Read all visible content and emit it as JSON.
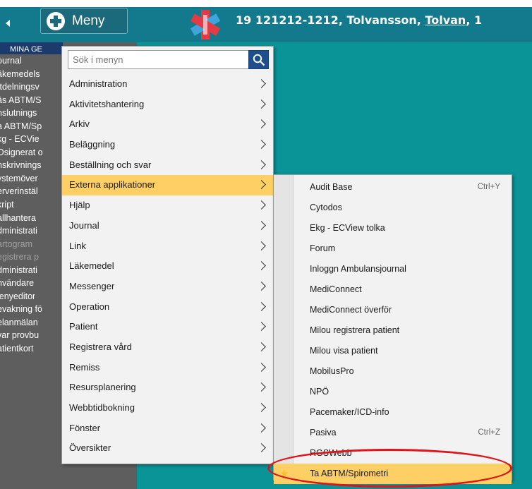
{
  "topbar": {
    "menu_label": "Meny",
    "patient_id": "19 121212-1212",
    "patient_surname": "Tolvansson",
    "patient_given": "Tolvan",
    "patient_trailing": "1"
  },
  "left_panel": {
    "header": "MINA GE",
    "items": [
      "ournal",
      "äkemedels",
      "Itdelningsv",
      "äs ABTM/S",
      "nslutnings",
      "a ABTM/Sp",
      "kg - ECVie",
      "Osignerat o",
      "nskrivnings",
      "ystemöver",
      "erverinstäl",
      "kript",
      "allhantera",
      "dministrati",
      "artogram",
      "egistrera p",
      "dministrati",
      "nvändare",
      "lenyeditor",
      "evakning fö",
      "elanmälan",
      "var provbu",
      "atientkort"
    ]
  },
  "menu": {
    "search_placeholder": "Sök i menyn",
    "items": [
      "Administration",
      "Aktivitetshantering",
      "Arkiv",
      "Beläggning",
      "Beställning och svar",
      "Externa applikationer",
      "Hjälp",
      "Journal",
      "Link",
      "Läkemedel",
      "Messenger",
      "Operation",
      "Patient",
      "Registrera vård",
      "Remiss",
      "Resursplanering",
      "Webbtidbokning",
      "Fönster",
      "Översikter"
    ],
    "active_index": 5
  },
  "submenu": {
    "items": [
      {
        "label": "Audit Base",
        "shortcut": "Ctrl+Y"
      },
      {
        "label": "Cytodos",
        "shortcut": ""
      },
      {
        "label": "Ekg - ECView tolka",
        "shortcut": ""
      },
      {
        "label": "Forum",
        "shortcut": ""
      },
      {
        "label": "Inloggn Ambulansjournal",
        "shortcut": ""
      },
      {
        "label": "MediConnect",
        "shortcut": ""
      },
      {
        "label": "MediConnect överför",
        "shortcut": ""
      },
      {
        "label": "Milou registrera patient",
        "shortcut": ""
      },
      {
        "label": "Milou visa patient",
        "shortcut": ""
      },
      {
        "label": "MobilusPro",
        "shortcut": ""
      },
      {
        "label": "NPÖ",
        "shortcut": ""
      },
      {
        "label": "Pacemaker/ICD-info",
        "shortcut": ""
      },
      {
        "label": "Pasiva",
        "shortcut": "Ctrl+Z"
      },
      {
        "label": "RGSWebb",
        "shortcut": ""
      },
      {
        "label": "Ta ABTM/Spirometri",
        "shortcut": ""
      }
    ],
    "selected_index": 14
  },
  "colors": {
    "topbar": "#13798c",
    "content": "#0b9498",
    "highlight": "#fdcf65",
    "annotation": "#e0131b"
  }
}
